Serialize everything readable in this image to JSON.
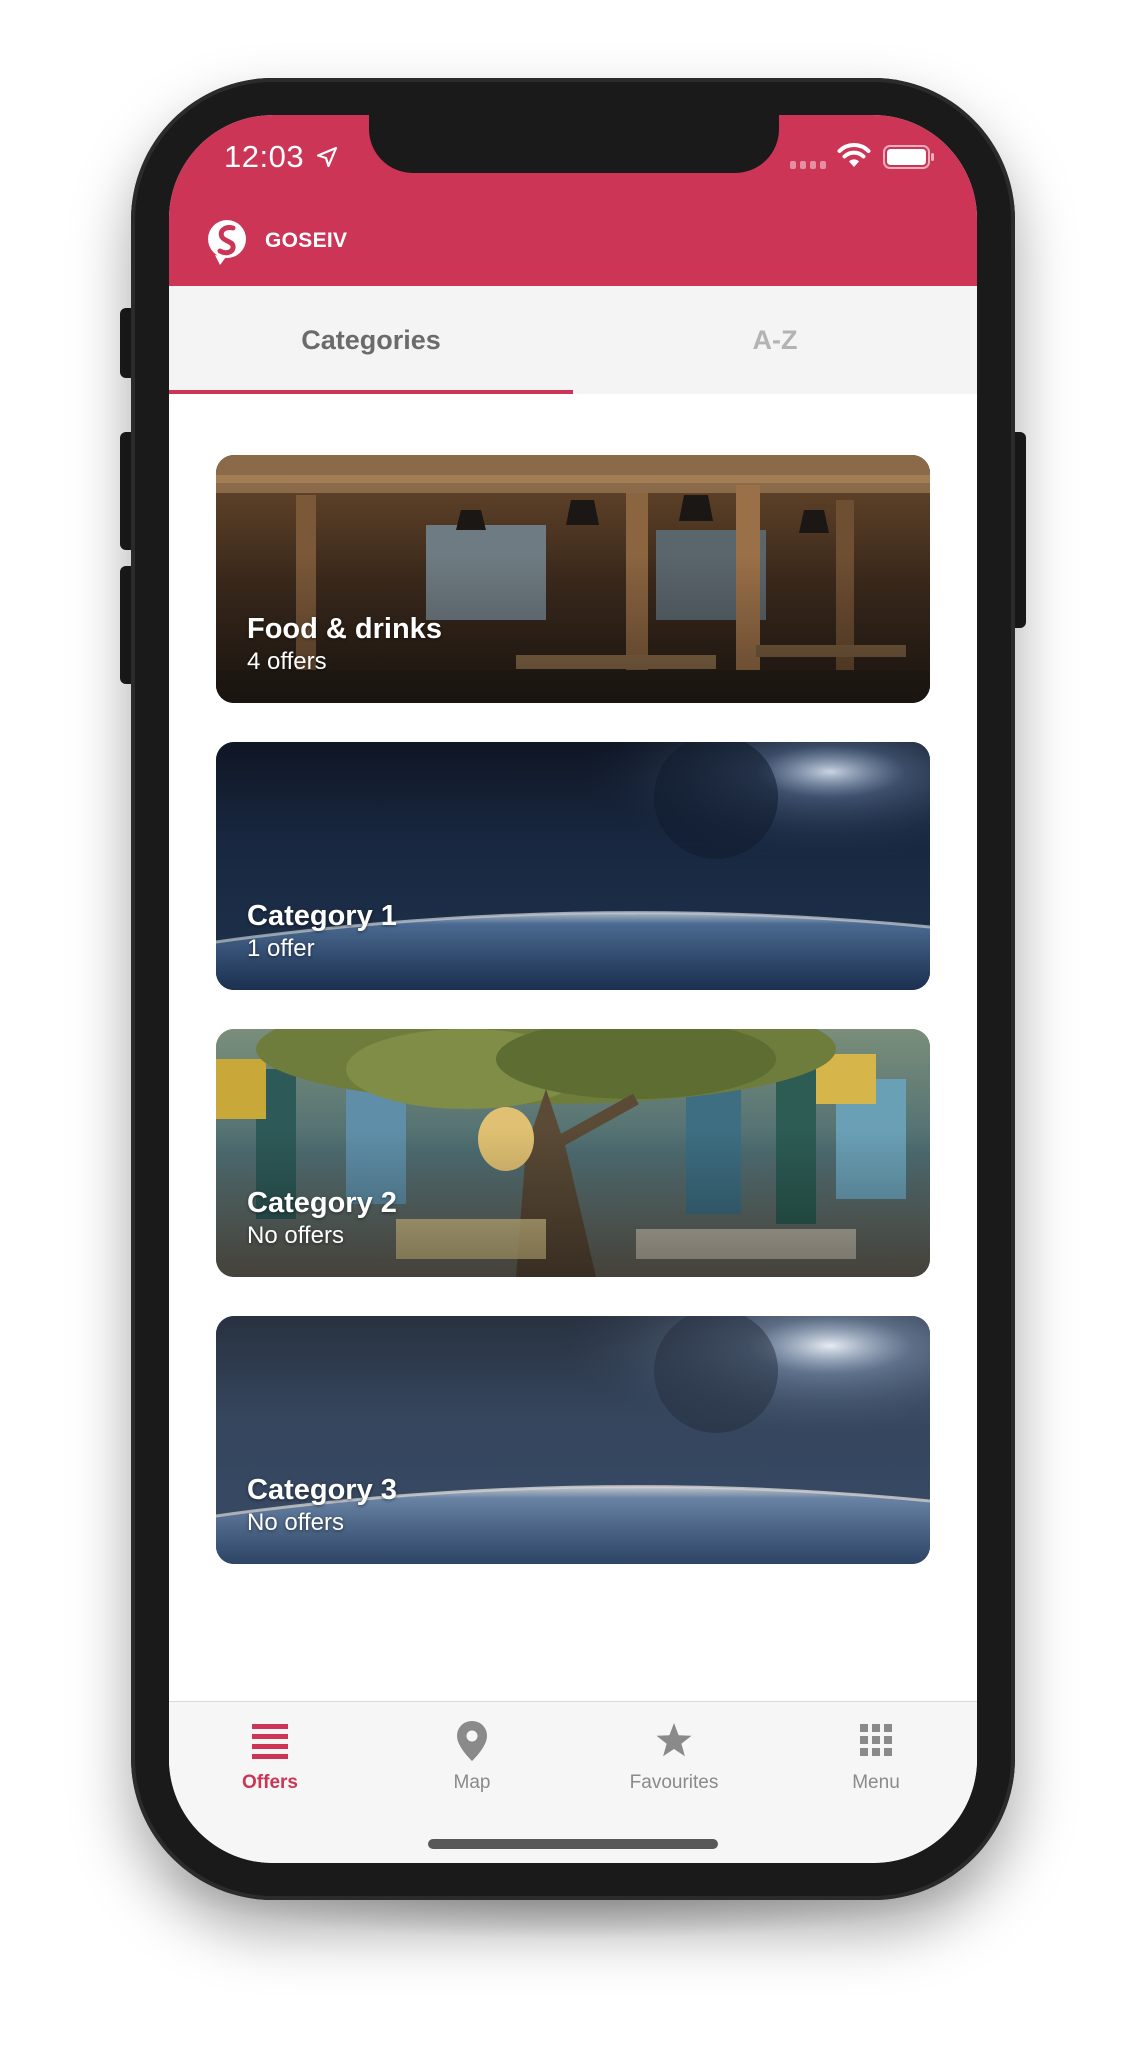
{
  "status_bar": {
    "time": "12:03"
  },
  "header": {
    "app_name": "GOSEIV",
    "accent_color": "#cc3556"
  },
  "tabs": [
    {
      "label": "Categories",
      "active": true
    },
    {
      "label": "A-Z",
      "active": false
    }
  ],
  "categories": [
    {
      "title": "Food & drinks",
      "subtitle": "4 offers",
      "image": "restaurant-interior"
    },
    {
      "title": "Category 1",
      "subtitle": "1 offer",
      "image": "earth-from-space"
    },
    {
      "title": "Category 2",
      "subtitle": "No offers",
      "image": "cafe-terrace-tree"
    },
    {
      "title": "Category 3",
      "subtitle": "No offers",
      "image": "earth-from-space"
    }
  ],
  "bottom_nav": [
    {
      "label": "Offers",
      "icon": "list-icon",
      "active": true
    },
    {
      "label": "Map",
      "icon": "map-pin-icon",
      "active": false
    },
    {
      "label": "Favourites",
      "icon": "star-icon",
      "active": false
    },
    {
      "label": "Menu",
      "icon": "grid-icon",
      "active": false
    }
  ]
}
